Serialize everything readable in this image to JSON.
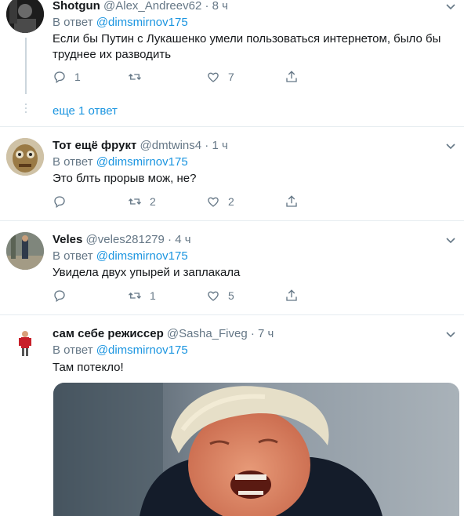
{
  "tweets": [
    {
      "name": "Shotgun",
      "handle": "@Alex_Andreev62",
      "dot": "·",
      "time": "8 ч",
      "reply_prefix": "В ответ",
      "reply_to": "@dimsmirnov175",
      "text": "Если бы Путин с Лукашенко умели пользоваться интернетом, было бы труднее их разводить",
      "replies": "1",
      "retweets": "",
      "likes": "7"
    },
    {
      "name": "Тот ещё фрукт",
      "handle": "@dmtwins4",
      "dot": "·",
      "time": "1 ч",
      "reply_prefix": "В ответ",
      "reply_to": "@dimsmirnov175",
      "text": "Это блть прорыв мож, не?",
      "replies": "",
      "retweets": "2",
      "likes": "2"
    },
    {
      "name": "Veles",
      "handle": "@veles281279",
      "dot": "·",
      "time": "4 ч",
      "reply_prefix": "В ответ",
      "reply_to": "@dimsmirnov175",
      "text": "Увидела двух упырей и заплакала",
      "replies": "",
      "retweets": "1",
      "likes": "5"
    },
    {
      "name": "сам себе режиссер",
      "handle": "@Sasha_Fiveg",
      "dot": "·",
      "time": "7 ч",
      "reply_prefix": "В ответ",
      "reply_to": "@dimsmirnov175",
      "text": "Там потекло!"
    }
  ],
  "show_more": "еще 1 ответ",
  "colors": {
    "link": "#1b95e0",
    "secondary": "#657786",
    "divider": "#e6ecf0"
  }
}
